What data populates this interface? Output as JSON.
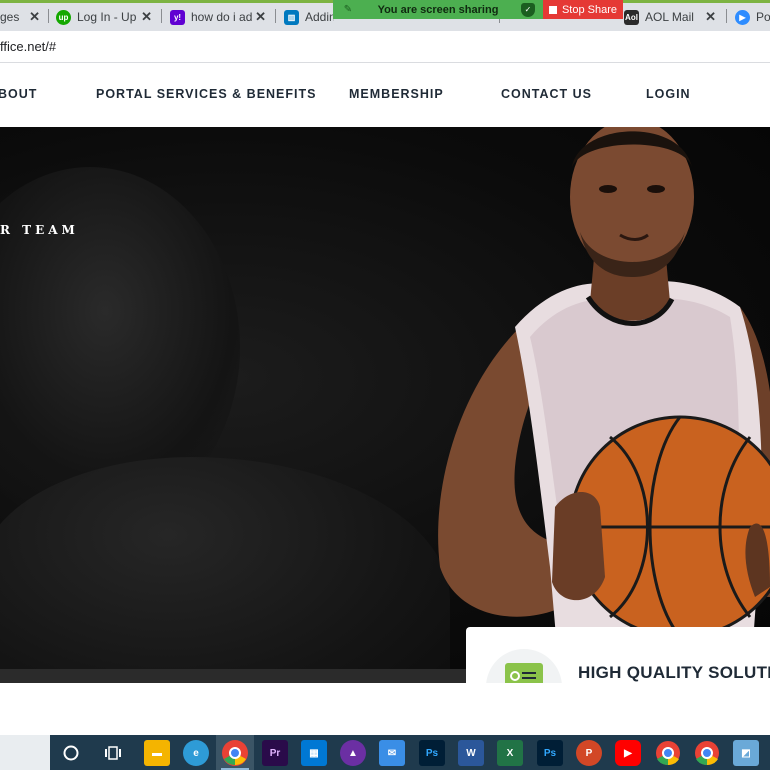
{
  "browser": {
    "tabs": [
      {
        "title": "ges",
        "icon": "page-icon",
        "color": "#9e9e9e"
      },
      {
        "title": "Log In - Up",
        "icon": "upwork-icon",
        "color": "#14a800"
      },
      {
        "title": "how do i ad",
        "icon": "yahoo-icon",
        "color": "#6001d2"
      },
      {
        "title": "Adding",
        "icon": "trello-icon",
        "color": "#0079bf"
      },
      {
        "title": "AOL Mail",
        "icon": "aol-icon",
        "color": "#2b2b2b"
      },
      {
        "title": "Po",
        "icon": "zoom-icon",
        "color": "#2d8cff"
      }
    ],
    "screen_share": {
      "message": "You are screen sharing",
      "stop_label": "Stop Share"
    },
    "url": "ffice.net/#"
  },
  "nav": {
    "items": [
      {
        "label": "BOUT"
      },
      {
        "label": "PORTAL SERVICES & BENEFITS"
      },
      {
        "label": "MEMBERSHIP"
      },
      {
        "label": "CONTACT US"
      },
      {
        "label": "LOGIN"
      }
    ]
  },
  "hero": {
    "tagline": "R TEAM"
  },
  "feature": {
    "title": "HIGH QUALITY SOLUTION"
  },
  "taskbar": {
    "apps": [
      {
        "name": "cortana-icon"
      },
      {
        "name": "task-view-icon"
      },
      {
        "name": "file-explorer-icon",
        "color": "#f4b400"
      },
      {
        "name": "edge-icon",
        "color": "#2e9bd6"
      },
      {
        "name": "chrome-icon",
        "color": "#e94235"
      },
      {
        "name": "premiere-icon",
        "label": "Pr",
        "color": "#2a0b4a"
      },
      {
        "name": "store-icon",
        "color": "#0078d4"
      },
      {
        "name": "affinity-icon",
        "color": "#6b2fa3"
      },
      {
        "name": "mail-icon",
        "color": "#3a8ee6"
      },
      {
        "name": "photoshop-icon",
        "label": "Ps",
        "color": "#001e36"
      },
      {
        "name": "word-icon",
        "label": "W",
        "color": "#2b579a"
      },
      {
        "name": "excel-icon",
        "label": "X",
        "color": "#217346"
      },
      {
        "name": "photoshop-2-icon",
        "label": "Ps",
        "color": "#001e36"
      },
      {
        "name": "powerpoint-icon",
        "label": "P",
        "color": "#d24726"
      },
      {
        "name": "youtube-icon",
        "color": "#ff0000"
      },
      {
        "name": "chrome-2-icon",
        "color": "#e94235"
      },
      {
        "name": "chrome-3-icon",
        "color": "#e94235"
      },
      {
        "name": "notes-icon",
        "color": "#6aa9d8"
      }
    ]
  }
}
